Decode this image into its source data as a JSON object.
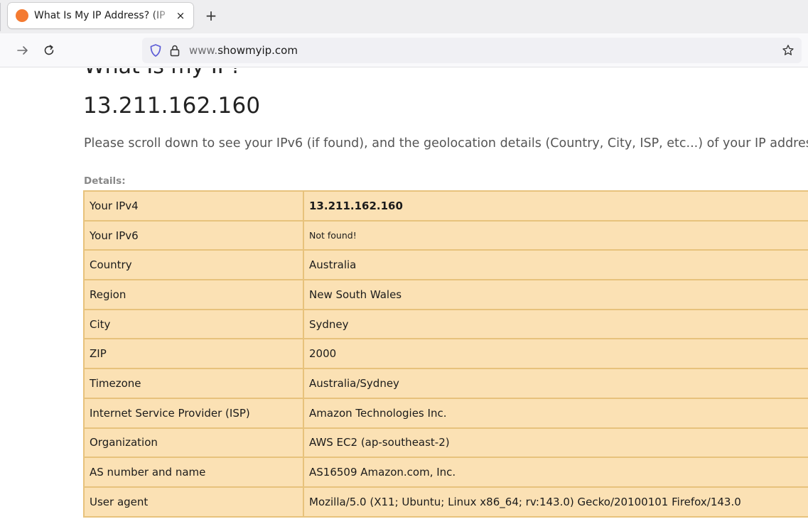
{
  "browser": {
    "tab": {
      "title": "What Is My IP Address? (IP",
      "close_glyph": "×",
      "favicon": "orange-circle-icon",
      "favicon_color": "#f47a31"
    },
    "new_tab_glyph": "+",
    "nav": {
      "forward_glyph": "→",
      "reload_glyph": "C"
    },
    "url": {
      "prefix": "www.",
      "domain": "showmyip.com"
    }
  },
  "page": {
    "cut_heading": "What Is my IP?",
    "ip_heading": "13.211.162.160",
    "intro": "Please scroll down to see your IPv6 (if found), and the geolocation details (Country, City, ISP, etc...) of your IP address.",
    "details_label": "Details:",
    "rows": [
      {
        "key": "Your IPv4",
        "value": "13.211.162.160"
      },
      {
        "key": "Your IPv6",
        "value": "Not found!"
      },
      {
        "key": "Country",
        "value": "Australia"
      },
      {
        "key": "Region",
        "value": "New South Wales"
      },
      {
        "key": "City",
        "value": "Sydney"
      },
      {
        "key": "ZIP",
        "value": "2000"
      },
      {
        "key": "Timezone",
        "value": "Australia/Sydney"
      },
      {
        "key": "Internet Service Provider (ISP)",
        "value": "Amazon Technologies Inc."
      },
      {
        "key": "Organization",
        "value": "AWS EC2 (ap-southeast-2)"
      },
      {
        "key": "AS number and name",
        "value": "AS16509 Amazon.com, Inc."
      },
      {
        "key": "User agent",
        "value": "Mozilla/5.0 (X11; Ubuntu; Linux x86_64; rv:143.0) Gecko/20100101 Firefox/143.0"
      }
    ]
  },
  "colors": {
    "table_bg": "#fbe1b4",
    "table_border": "#e7c27c",
    "favicon": "#f47a31"
  }
}
